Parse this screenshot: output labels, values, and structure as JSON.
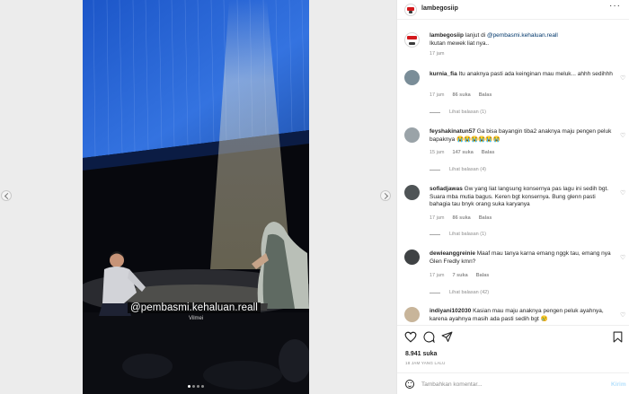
{
  "post": {
    "watermark": "@pembasmi.kehaluan.reall",
    "subcaption": "Vilmei",
    "carousel_dots": 4,
    "active_dot": 0
  },
  "header": {
    "username": "lambegosiip",
    "more_label": "···"
  },
  "caption": {
    "username": "lambegosiip",
    "text_before": "lanjut di",
    "mention": "@pembasmi.kehaluan.reall",
    "line2": "Ikutan mewek liat nya..",
    "time": "17 jam"
  },
  "comments": [
    {
      "username": "kurnia_fia",
      "text": "Itu anaknya pasti ada keinginan mau meluk... ahhh sedihhh",
      "time": "17 jam",
      "likes": "86 suka",
      "reply_label": "Balas",
      "view_replies": "Lihat balasan (1)"
    },
    {
      "username": "feyshakinatun57",
      "text": "Ga bisa bayangin tiba2 anaknya maju pengen peluk bapaknya 😭😭😭😭😭😭",
      "time": "15 jam",
      "likes": "147 suka",
      "reply_label": "Balas",
      "view_replies": "Lihat balasan (4)"
    },
    {
      "username": "sofiadjawas",
      "text": "Gw yang liat langsung konsernya pas lagu ini sedih bgt. Suara mba mutia bagus. Keren bgt konsernya. Bung glenn pasti bahagia tau bnyk orang suka karyanya",
      "time": "17 jam",
      "likes": "86 suka",
      "reply_label": "Balas",
      "view_replies": "Lihat balasan (1)"
    },
    {
      "username": "dewieanggreinie",
      "text": "Maaf mau tanya karna emang nggk tau, emang nya Glen Fredly kmn?",
      "time": "17 jam",
      "likes": "7 suka",
      "reply_label": "Balas",
      "view_replies": "Lihat balasan (42)"
    },
    {
      "username": "indiyani102030",
      "text": "Kasian mau maju anaknya pengen peluk ayahnya, karena ayahnya masih ada pasti sedih bgt 😢",
      "time": "",
      "likes": "",
      "reply_label": "",
      "view_replies": ""
    }
  ],
  "actions": {
    "likes": "8.941 suka",
    "time_ago": "18 JAM YANG LALU",
    "add_comment_placeholder": "Tambahkan komentar...",
    "post_label": "Kirim"
  },
  "icons": [
    "heart-icon",
    "comment-icon",
    "share-icon",
    "bookmark-icon",
    "emoji-icon",
    "more-icon",
    "sound-icon"
  ]
}
